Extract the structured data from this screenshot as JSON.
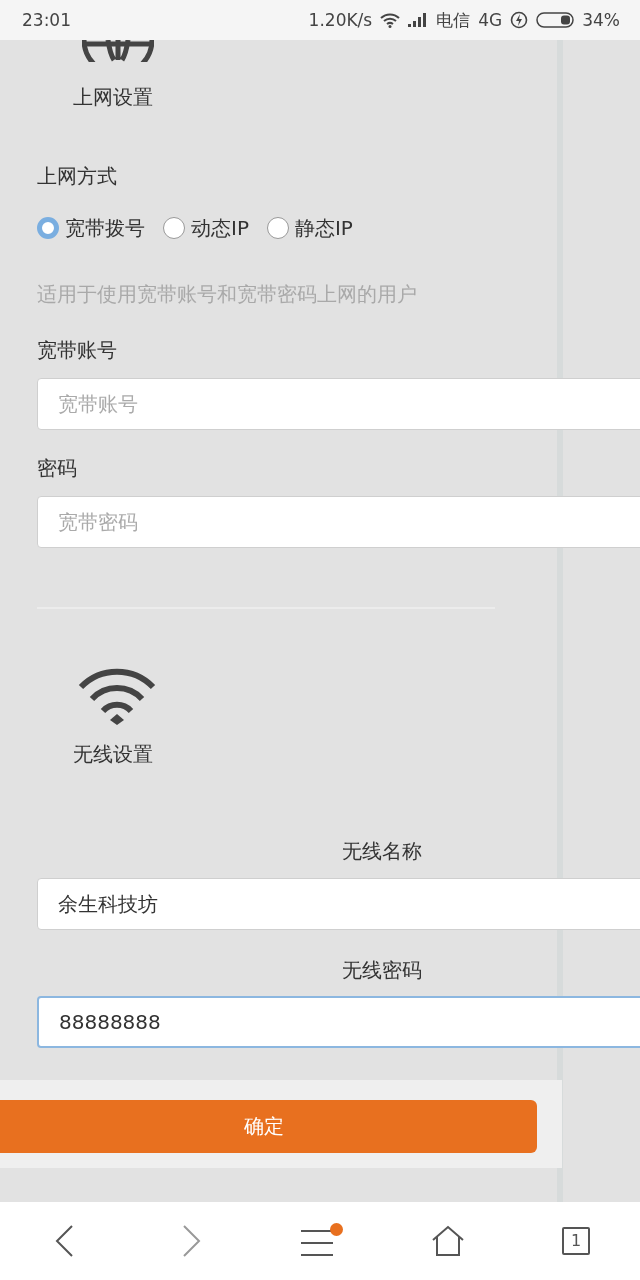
{
  "status_bar": {
    "time": "23:01",
    "net_speed": "1.20K/s",
    "carrier": "电信",
    "network_type": "4G",
    "battery_percent": "34%"
  },
  "internet_settings": {
    "title": "上网设置",
    "connection_type_label": "上网方式",
    "options": [
      {
        "label": "宽带拨号",
        "selected": true
      },
      {
        "label": "动态IP",
        "selected": false
      },
      {
        "label": "静态IP",
        "selected": false
      }
    ],
    "hint": "适用于使用宽带账号和宽带密码上网的用户",
    "fields": [
      {
        "label": "宽带账号",
        "placeholder": "宽带账号"
      },
      {
        "label": "密码",
        "placeholder": "宽带密码"
      }
    ]
  },
  "wireless_settings": {
    "title": "无线设置",
    "fields": [
      {
        "label": "无线名称",
        "value": "余生科技坊",
        "focused": false
      },
      {
        "label": "无线密码",
        "value": "88888888",
        "focused": true
      }
    ]
  },
  "confirm_button": "确定",
  "bottom_nav": {
    "tab_count": "1",
    "menu_badge": true
  }
}
